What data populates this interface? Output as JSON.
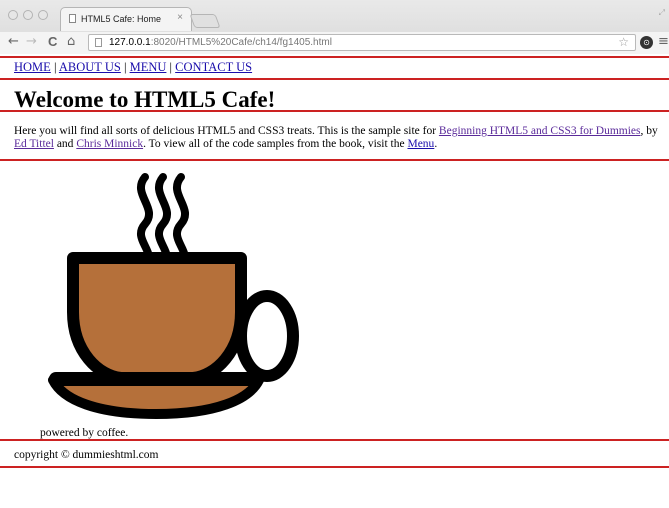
{
  "browser": {
    "tab_title": "HTML5 Cafe: Home",
    "tab_close": "×",
    "url_host": "127.0.0.1",
    "url_rest": ":8020/HTML5%20Cafe/ch14/fg1405.html",
    "back": "←",
    "forward": "→",
    "reload": "C",
    "home": "⌂",
    "star": "☆",
    "menu": "≡"
  },
  "nav": {
    "home": "HOME",
    "about": "ABOUT US",
    "menu": "MENU",
    "contact": "CONTACT US",
    "separator": "|"
  },
  "heading": "Welcome to HTML5 Cafe!",
  "intro": {
    "part1": "Here you will find all sorts of delicious HTML5 and CSS3 treats. This is the sample site for ",
    "book_link": "Beginning HTML5 and CSS3 for Dummies",
    "part2": ", by ",
    "author1_link": "Ed Tittel",
    "part3": " and ",
    "author2_link": "Chris Minnick",
    "part4": ". To view all of the code samples from the book, visit the ",
    "menu_link": "Menu",
    "part5": "."
  },
  "figure": {
    "icon": "coffee-cup-icon",
    "caption": "powered by coffee."
  },
  "footer": {
    "copyright": "copyright © dummieshtml.com"
  },
  "colors": {
    "rule": "#cc2222",
    "coffee": "#b5703a",
    "link": "#1a0dab",
    "visited_link": "#5a2a9a"
  }
}
